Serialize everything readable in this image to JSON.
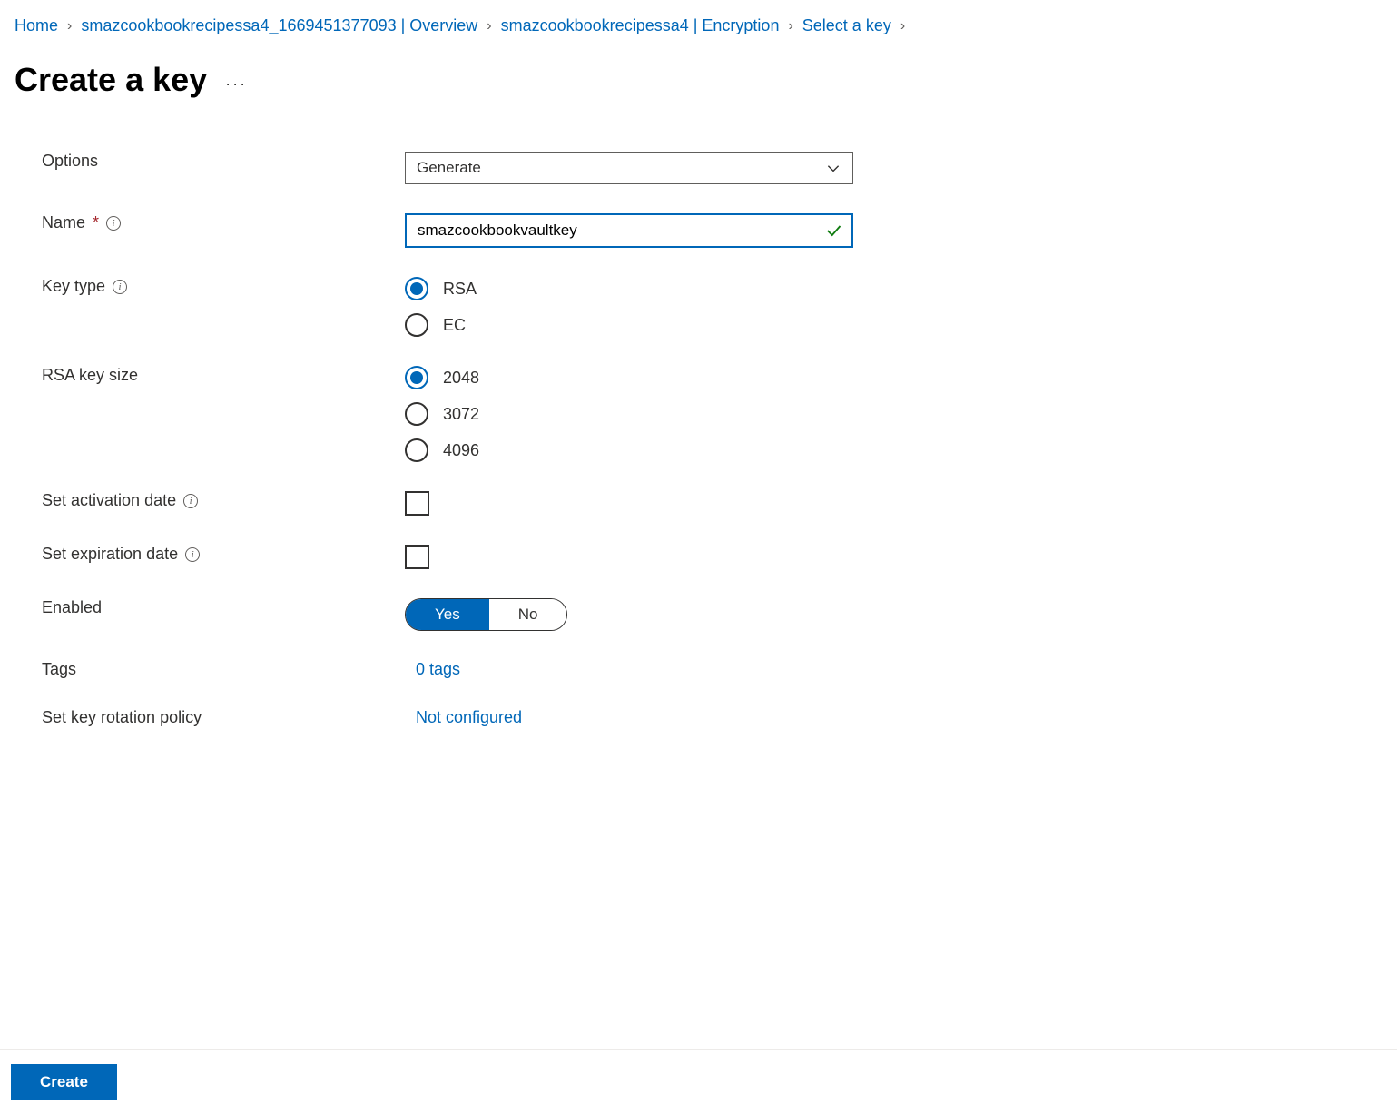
{
  "breadcrumb": {
    "items": [
      {
        "label": "Home"
      },
      {
        "label": "smazcookbookrecipessa4_1669451377093 | Overview"
      },
      {
        "label": "smazcookbookrecipessa4 | Encryption"
      },
      {
        "label": "Select a key"
      }
    ]
  },
  "page": {
    "title": "Create a key"
  },
  "form": {
    "options": {
      "label": "Options",
      "value": "Generate"
    },
    "name": {
      "label": "Name",
      "value": "smazcookbookvaultkey"
    },
    "key_type": {
      "label": "Key type",
      "options": [
        {
          "label": "RSA",
          "selected": true
        },
        {
          "label": "EC",
          "selected": false
        }
      ]
    },
    "rsa_key_size": {
      "label": "RSA key size",
      "options": [
        {
          "label": "2048",
          "selected": true
        },
        {
          "label": "3072",
          "selected": false
        },
        {
          "label": "4096",
          "selected": false
        }
      ]
    },
    "activation": {
      "label": "Set activation date",
      "checked": false
    },
    "expiration": {
      "label": "Set expiration date",
      "checked": false
    },
    "enabled": {
      "label": "Enabled",
      "yes": "Yes",
      "no": "No",
      "value": true
    },
    "tags": {
      "label": "Tags",
      "value": "0 tags"
    },
    "rotation": {
      "label": "Set key rotation policy",
      "value": "Not configured"
    }
  },
  "actions": {
    "create": "Create"
  }
}
